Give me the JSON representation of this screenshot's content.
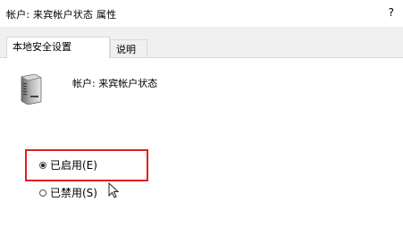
{
  "window": {
    "title": "帐户: 来宾帐户状态 属性",
    "help_label": "?"
  },
  "tabs": [
    {
      "label": "本地安全设置",
      "active": true
    },
    {
      "label": "说明",
      "active": false
    }
  ],
  "panel": {
    "icon": "server-icon",
    "account_label": "帐户: 来宾帐户状态",
    "options": [
      {
        "label": "已启用(E)",
        "checked": true
      },
      {
        "label": "已禁用(S)",
        "checked": false
      }
    ],
    "highlight_color": "#e02020"
  }
}
